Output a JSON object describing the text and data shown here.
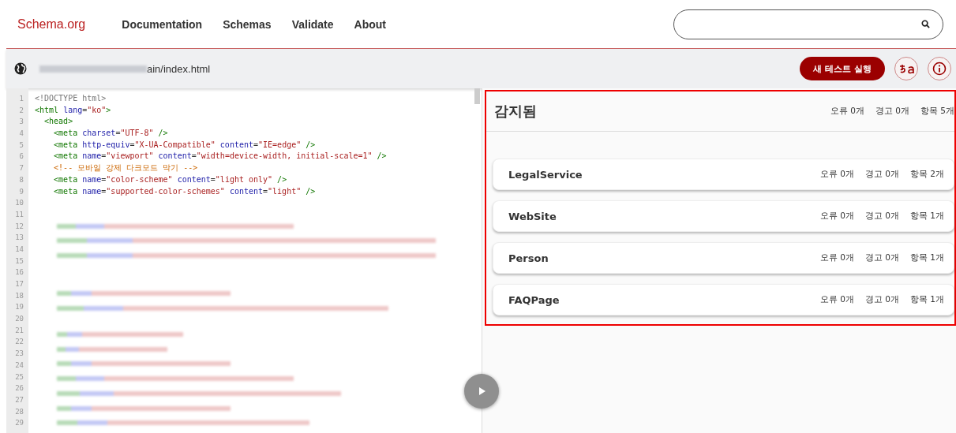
{
  "nav": {
    "logo": "Schema.org",
    "links": [
      "Documentation",
      "Schemas",
      "Validate",
      "About"
    ]
  },
  "toolbar": {
    "url_visible": "ain/index.html",
    "run_button": "새 테스트 실행"
  },
  "code": {
    "lines": [
      {
        "number": "1",
        "kind": "code",
        "tokens": [
          {
            "kind": "doctype",
            "text": "<!DOCTYPE html>"
          }
        ]
      },
      {
        "number": "2",
        "kind": "code",
        "tokens": [
          {
            "kind": "tag",
            "text": "<html "
          },
          {
            "kind": "attr",
            "text": "lang"
          },
          {
            "kind": "plain",
            "text": "="
          },
          {
            "kind": "string",
            "text": "\"ko\""
          },
          {
            "kind": "tag",
            "text": ">"
          }
        ]
      },
      {
        "number": "3",
        "kind": "code",
        "tokens": [
          {
            "kind": "tag",
            "text": "  <head>"
          }
        ]
      },
      {
        "number": "4",
        "kind": "code",
        "tokens": [
          {
            "kind": "tag",
            "text": "    <meta "
          },
          {
            "kind": "attr",
            "text": "charset"
          },
          {
            "kind": "plain",
            "text": "="
          },
          {
            "kind": "string",
            "text": "\"UTF-8\""
          },
          {
            "kind": "tag",
            "text": " />"
          }
        ]
      },
      {
        "number": "5",
        "kind": "code",
        "tokens": [
          {
            "kind": "tag",
            "text": "    <meta "
          },
          {
            "kind": "attr",
            "text": "http-equiv"
          },
          {
            "kind": "plain",
            "text": "="
          },
          {
            "kind": "string",
            "text": "\"X-UA-Compatible\""
          },
          {
            "kind": "attr",
            "text": " content"
          },
          {
            "kind": "plain",
            "text": "="
          },
          {
            "kind": "string",
            "text": "\"IE=edge\""
          },
          {
            "kind": "tag",
            "text": " />"
          }
        ]
      },
      {
        "number": "6",
        "kind": "code",
        "tokens": [
          {
            "kind": "tag",
            "text": "    <meta "
          },
          {
            "kind": "attr",
            "text": "name"
          },
          {
            "kind": "plain",
            "text": "="
          },
          {
            "kind": "string",
            "text": "\"viewport\""
          },
          {
            "kind": "attr",
            "text": " content"
          },
          {
            "kind": "plain",
            "text": "="
          },
          {
            "kind": "string",
            "text": "\"width=device-width, initial-scale=1\""
          },
          {
            "kind": "tag",
            "text": " />"
          }
        ]
      },
      {
        "number": "7",
        "kind": "code",
        "tokens": [
          {
            "kind": "comment",
            "text": "    <!-- 모바일 강제 다크모드 막기 -->"
          }
        ]
      },
      {
        "number": "8",
        "kind": "code",
        "tokens": [
          {
            "kind": "tag",
            "text": "    <meta "
          },
          {
            "kind": "attr",
            "text": "name"
          },
          {
            "kind": "plain",
            "text": "="
          },
          {
            "kind": "string",
            "text": "\"color-scheme\""
          },
          {
            "kind": "attr",
            "text": " content"
          },
          {
            "kind": "plain",
            "text": "="
          },
          {
            "kind": "string",
            "text": "\"light only\""
          },
          {
            "kind": "tag",
            "text": " />"
          }
        ]
      },
      {
        "number": "9",
        "kind": "code",
        "tokens": [
          {
            "kind": "tag",
            "text": "    <meta "
          },
          {
            "kind": "attr",
            "text": "name"
          },
          {
            "kind": "plain",
            "text": "="
          },
          {
            "kind": "string",
            "text": "\"supported-color-schemes\""
          },
          {
            "kind": "attr",
            "text": " content"
          },
          {
            "kind": "plain",
            "text": "="
          },
          {
            "kind": "string",
            "text": "\"light\""
          },
          {
            "kind": "tag",
            "text": " />"
          }
        ]
      },
      {
        "number": "10",
        "kind": "blank"
      },
      {
        "number": "11",
        "kind": "blank"
      },
      {
        "number": "12",
        "kind": "redacted"
      },
      {
        "number": "13",
        "kind": "redacted"
      },
      {
        "number": "14",
        "kind": "redacted"
      },
      {
        "number": "15",
        "kind": "blank"
      },
      {
        "number": "16",
        "kind": "blank"
      },
      {
        "number": "17",
        "kind": "redacted"
      },
      {
        "number": "18",
        "kind": "redacted"
      },
      {
        "number": "19",
        "kind": "blank"
      },
      {
        "number": "20",
        "kind": "redacted"
      },
      {
        "number": "21",
        "kind": "redacted"
      },
      {
        "number": "22",
        "kind": "redacted"
      },
      {
        "number": "23",
        "kind": "redacted"
      },
      {
        "number": "24",
        "kind": "redacted"
      },
      {
        "number": "25",
        "kind": "redacted"
      },
      {
        "number": "26",
        "kind": "redacted"
      },
      {
        "number": "27",
        "kind": "blank"
      },
      {
        "number": "28",
        "kind": "redacted"
      },
      {
        "number": "29",
        "kind": "redacted"
      }
    ]
  },
  "results": {
    "title": "감지됨",
    "stats": [
      "오류 0개",
      "경고 0개",
      "항목 5개"
    ],
    "items": [
      {
        "name": "LegalService",
        "stats": [
          "오류 0개",
          "경고 0개",
          "항목 2개"
        ]
      },
      {
        "name": "WebSite",
        "stats": [
          "오류 0개",
          "경고 0개",
          "항목 1개"
        ]
      },
      {
        "name": "Person",
        "stats": [
          "오류 0개",
          "경고 0개",
          "항목 1개"
        ]
      },
      {
        "name": "FAQPage",
        "stats": [
          "오류 0개",
          "경고 0개",
          "항목 1개"
        ]
      }
    ]
  }
}
